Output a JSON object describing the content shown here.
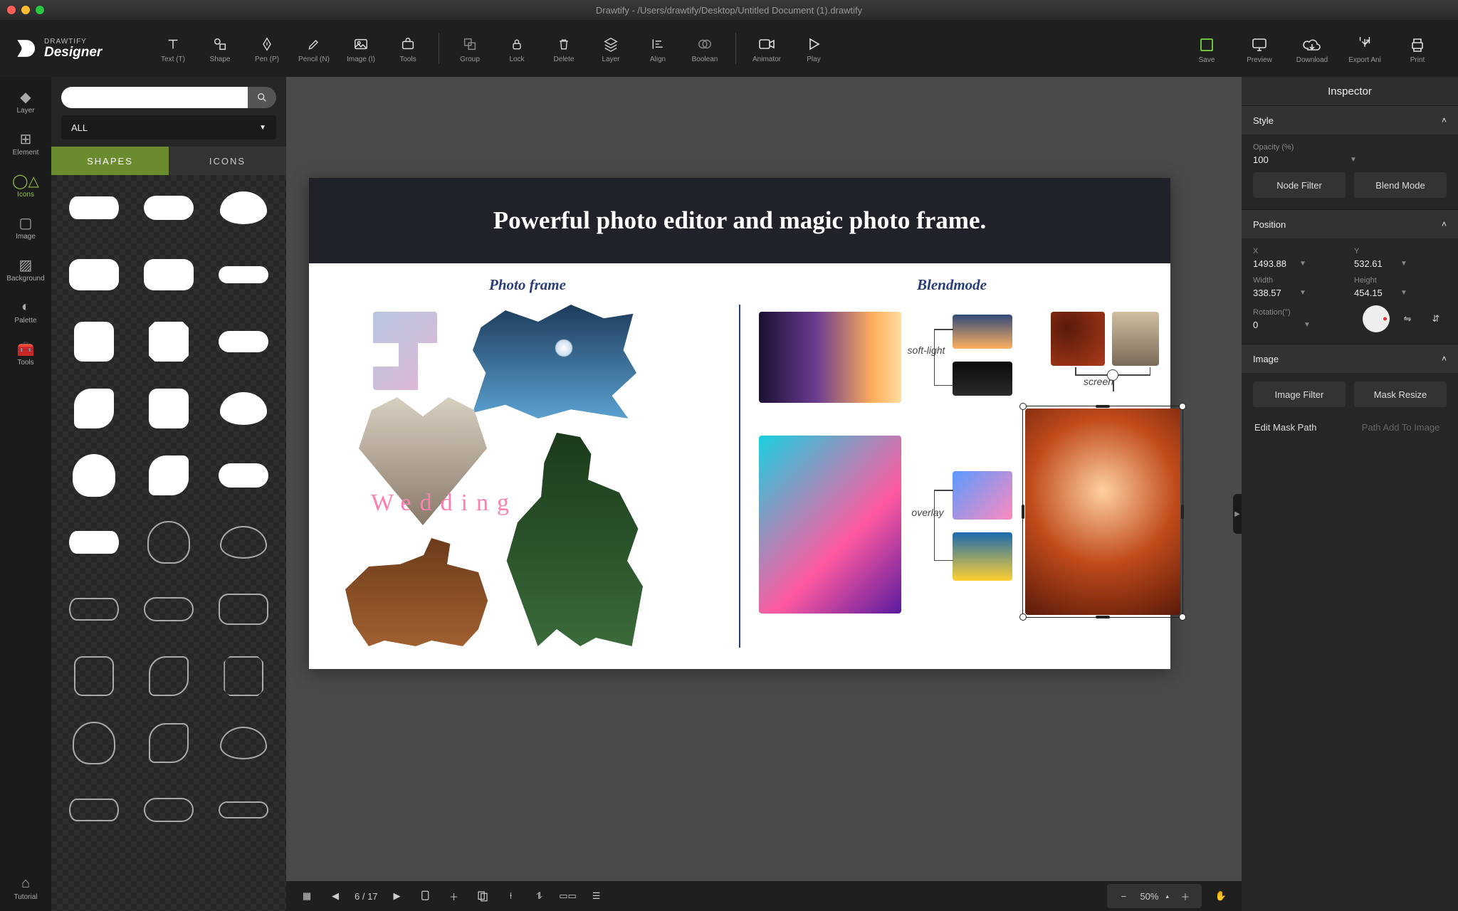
{
  "app": {
    "title": "Drawtify - /Users/drawtify/Desktop/Untitled Document (1).drawtify",
    "brand_small": "DRAWTIFY",
    "brand_big": "Designer"
  },
  "toolbar": {
    "text": "Text (T)",
    "shape": "Shape",
    "pen": "Pen (P)",
    "pencil": "Pencil (N)",
    "image": "Image (I)",
    "tools": "Tools",
    "group": "Group",
    "lock": "Lock",
    "delete": "Delete",
    "layer": "Layer",
    "align": "Align",
    "boolean": "Boolean",
    "animator": "Animator",
    "play": "Play",
    "save": "Save",
    "preview": "Preview",
    "download": "Download",
    "export_ani": "Export Ani",
    "print": "Print"
  },
  "strip": {
    "layer": "Layer",
    "element": "Element",
    "icons": "Icons",
    "image": "Image",
    "background": "Background",
    "palette": "Palette",
    "tools": "Tools",
    "tutorial": "Tutorial"
  },
  "panel": {
    "search_placeholder": "",
    "filter": "ALL",
    "tab_shapes": "SHAPES",
    "tab_icons": "ICONS"
  },
  "canvas": {
    "headline": "Powerful photo editor and magic photo frame.",
    "left_title": "Photo frame",
    "right_title": "Blendmode",
    "wedding": "Wedding",
    "softlight": "soft-light",
    "overlay": "overlay",
    "screen": "screen"
  },
  "bottom": {
    "page": "6 / 17",
    "zoom": "50%"
  },
  "inspector": {
    "title": "Inspector",
    "sec_style": "Style",
    "opacity_label": "Opacity (%)",
    "opacity": "100",
    "node_filter": "Node Filter",
    "blend_mode": "Blend Mode",
    "sec_position": "Position",
    "x_label": "X",
    "x": "1493.88",
    "y_label": "Y",
    "y": "532.61",
    "w_label": "Width",
    "w": "338.57",
    "h_label": "Height",
    "h": "454.15",
    "rot_label": "Rotation(°)",
    "rot": "0",
    "sec_image": "Image",
    "image_filter": "Image Filter",
    "mask_resize": "Mask Resize",
    "edit_mask": "Edit Mask Path",
    "path_add": "Path Add To Image"
  }
}
